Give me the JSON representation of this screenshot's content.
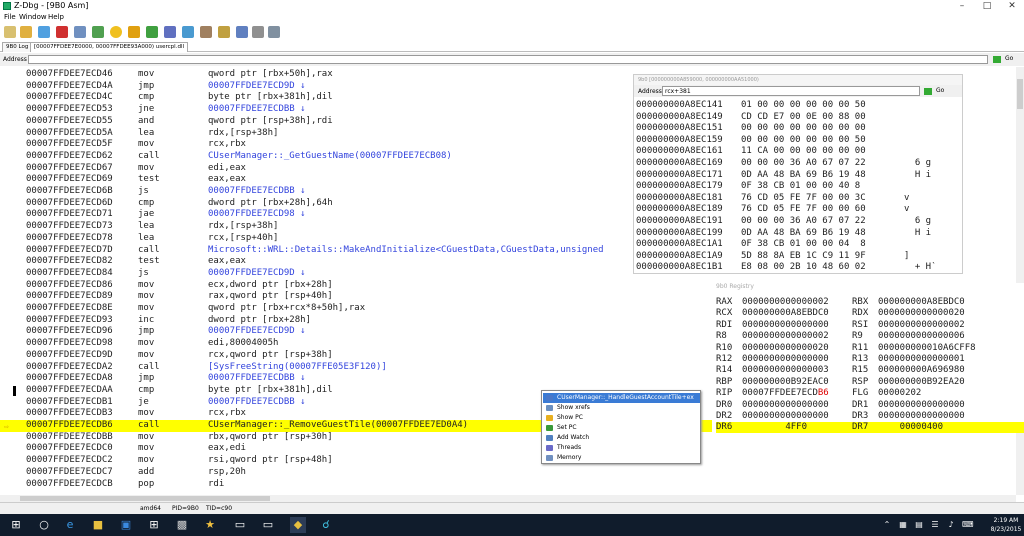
{
  "window": {
    "title": "Z-Dbg - [9B0 Asm]"
  },
  "menu": [
    "File",
    "Window",
    "Help"
  ],
  "tabs": [
    "9B0 Log",
    "[00007FFDEE7E0000, 00007FFDEE93A000) usercpl.dll"
  ],
  "address_bar": {
    "label": "Address",
    "value": "",
    "go": "Go"
  },
  "disasm": [
    {
      "addr": "00007FFDEE7ECD46",
      "mn": "mov",
      "op": "qword ptr [rbx+50h],rax"
    },
    {
      "addr": "00007FFDEE7ECD4A",
      "mn": "jmp",
      "op": "00007FFDEE7ECD9D ↓",
      "link": true
    },
    {
      "addr": "00007FFDEE7ECD4C",
      "mn": "cmp",
      "op": "byte ptr [rbx+381h],dil"
    },
    {
      "addr": "00007FFDEE7ECD53",
      "mn": "jne",
      "op": "00007FFDEE7ECDBB ↓",
      "link": true
    },
    {
      "addr": "00007FFDEE7ECD55",
      "mn": "and",
      "op": "qword ptr [rsp+38h],rdi"
    },
    {
      "addr": "00007FFDEE7ECD5A",
      "mn": "lea",
      "op": "rdx,[rsp+38h]"
    },
    {
      "addr": "00007FFDEE7ECD5F",
      "mn": "mov",
      "op": "rcx,rbx"
    },
    {
      "addr": "00007FFDEE7ECD62",
      "mn": "call",
      "op": "CUserManager::_GetGuestName(00007FFDEE7ECB08)",
      "link": true
    },
    {
      "addr": "00007FFDEE7ECD67",
      "mn": "mov",
      "op": "edi,eax"
    },
    {
      "addr": "00007FFDEE7ECD69",
      "mn": "test",
      "op": "eax,eax"
    },
    {
      "addr": "00007FFDEE7ECD6B",
      "mn": "js",
      "op": "00007FFDEE7ECDBB ↓",
      "link": true
    },
    {
      "addr": "00007FFDEE7ECD6D",
      "mn": "cmp",
      "op": "dword ptr [rbx+28h],64h"
    },
    {
      "addr": "00007FFDEE7ECD71",
      "mn": "jae",
      "op": "00007FFDEE7ECD98 ↓",
      "link": true
    },
    {
      "addr": "00007FFDEE7ECD73",
      "mn": "lea",
      "op": "rdx,[rsp+38h]"
    },
    {
      "addr": "00007FFDEE7ECD78",
      "mn": "lea",
      "op": "rcx,[rsp+40h]"
    },
    {
      "addr": "00007FFDEE7ECD7D",
      "mn": "call",
      "op": "Microsoft::WRL::Details::MakeAndInitialize<CGuestData,CGuestData,unsigned",
      "link": true
    },
    {
      "addr": "00007FFDEE7ECD82",
      "mn": "test",
      "op": "eax,eax"
    },
    {
      "addr": "00007FFDEE7ECD84",
      "mn": "js",
      "op": "00007FFDEE7ECD9D ↓",
      "link": true
    },
    {
      "addr": "00007FFDEE7ECD86",
      "mn": "mov",
      "op": "ecx,dword ptr [rbx+28h]"
    },
    {
      "addr": "00007FFDEE7ECD89",
      "mn": "mov",
      "op": "rax,qword ptr [rsp+40h]"
    },
    {
      "addr": "00007FFDEE7ECD8E",
      "mn": "mov",
      "op": "qword ptr [rbx+rcx*8+50h],rax"
    },
    {
      "addr": "00007FFDEE7ECD93",
      "mn": "inc",
      "op": "dword ptr [rbx+28h]"
    },
    {
      "addr": "00007FFDEE7ECD96",
      "mn": "jmp",
      "op": "00007FFDEE7ECD9D ↓",
      "link": true
    },
    {
      "addr": "00007FFDEE7ECD98",
      "mn": "mov",
      "op": "edi,80004005h"
    },
    {
      "addr": "00007FFDEE7ECD9D",
      "mn": "mov",
      "op": "rcx,qword ptr [rsp+38h]"
    },
    {
      "addr": "00007FFDEE7ECDA2",
      "mn": "call",
      "op": "[SysFreeString(00007FFE05E3F120)]",
      "link": true
    },
    {
      "addr": "00007FFDEE7ECDA8",
      "mn": "jmp",
      "op": "00007FFDEE7ECDBB ↓",
      "link": true
    },
    {
      "addr": "00007FFDEE7ECDAA",
      "mn": "cmp",
      "op": "byte ptr [rbx+381h],dil",
      "bp": true
    },
    {
      "addr": "00007FFDEE7ECDB1",
      "mn": "je",
      "op": "00007FFDEE7ECDBB ↓",
      "link": true
    },
    {
      "addr": "00007FFDEE7ECDB3",
      "mn": "mov",
      "op": "rcx,rbx"
    },
    {
      "addr": "00007FFDEE7ECDB6",
      "mn": "call",
      "op": "CUserManager::_RemoveGuestTile(00007FFDEE7ED0A4)",
      "current": true
    },
    {
      "addr": "00007FFDEE7ECDBB",
      "mn": "mov",
      "op": "rbx,qword ptr [rsp+30h]"
    },
    {
      "addr": "00007FFDEE7ECDC0",
      "mn": "mov",
      "op": "eax,edi"
    },
    {
      "addr": "00007FFDEE7ECDC2",
      "mn": "mov",
      "op": "rsi,qword ptr [rsp+48h]"
    },
    {
      "addr": "00007FFDEE7ECDC7",
      "mn": "add",
      "op": "rsp,20h"
    },
    {
      "addr": "00007FFDEE7ECDCB",
      "mn": "pop",
      "op": "rdi"
    }
  ],
  "memory": {
    "title": "9b0 [000000000A859000, 000000000AA51000)",
    "address_label": "Address",
    "address_value": "rcx+381",
    "go": "Go",
    "rows": [
      {
        "addr": "000000000A8EC141",
        "hex": "01 00 00 00 00 00 00 50",
        "ascii": ""
      },
      {
        "addr": "000000000A8EC149",
        "hex": "CD CD E7 00 0E 00 88 00",
        "ascii": ""
      },
      {
        "addr": "000000000A8EC151",
        "hex": "00 00 00 00 00 00 00 00",
        "ascii": ""
      },
      {
        "addr": "000000000A8EC159",
        "hex": "00 00 00 00 00 00 00 50",
        "ascii": ""
      },
      {
        "addr": "000000000A8EC161",
        "hex": "11 CA 00 00 00 00 00 00",
        "ascii": ""
      },
      {
        "addr": "000000000A8EC169",
        "hex": "00 00 00 36 A0 67 07 22",
        "ascii": "  6 g"
      },
      {
        "addr": "000000000A8EC171",
        "hex": "0D AA 48 BA 69 B6 19 48",
        "ascii": "  H i"
      },
      {
        "addr": "000000000A8EC179",
        "hex": "0F 38 CB 01 00 00 40 8",
        "ascii": ""
      },
      {
        "addr": "000000000A8EC181",
        "hex": "76 CD 05 FE 7F 00 00 3C",
        "ascii": "v"
      },
      {
        "addr": "000000000A8EC189",
        "hex": "76 CD 05 FE 7F 00 00 60",
        "ascii": "v"
      },
      {
        "addr": "000000000A8EC191",
        "hex": "00 00 00 36 A0 67 07 22",
        "ascii": "  6 g"
      },
      {
        "addr": "000000000A8EC199",
        "hex": "0D AA 48 BA 69 B6 19 48",
        "ascii": "  H i"
      },
      {
        "addr": "000000000A8EC1A1",
        "hex": "0F 38 CB 01 00 00 04  8",
        "ascii": ""
      },
      {
        "addr": "000000000A8EC1A9",
        "hex": "5D 88 8A EB 1C C9 11 9F",
        "ascii": "]"
      },
      {
        "addr": "000000000A8EC1B1",
        "hex": "E8 08 00 2B 10 48 60 02",
        "ascii": "  + H`"
      }
    ]
  },
  "registers": {
    "title": "9b0 Registry",
    "rows": [
      {
        "n1": "RAX",
        "v1": "0000000000000002",
        "n2": "RBX",
        "v2": "000000000A8EBDC0"
      },
      {
        "n1": "RCX",
        "v1": "000000000A8EBDC0",
        "n2": "RDX",
        "v2": "0000000000000020"
      },
      {
        "n1": "RDI",
        "v1": "0000000000000000",
        "n2": "RSI",
        "v2": "0000000000000002"
      },
      {
        "n1": "R8",
        "v1": "0000000000000002",
        "n2": "R9",
        "v2": "0000000000000006"
      },
      {
        "n1": "R10",
        "v1": "0000000000000020",
        "n2": "R11",
        "v2": "000000000010A6CFF8"
      },
      {
        "n1": "R12",
        "v1": "0000000000000000",
        "n2": "R13",
        "v2": "0000000000000001"
      },
      {
        "n1": "R14",
        "v1": "0000000000000003",
        "n2": "R15",
        "v2": "000000000A696980"
      },
      {
        "n1": "RBP",
        "v1": "000000000B92EAC0",
        "n2": "RSP",
        "v2": "000000000B92EA20"
      },
      {
        "n1": "RIP",
        "v1": "00007FFDEE7ECD",
        "v1red": "B6",
        "n2": "FLG",
        "v2": "00000202"
      },
      {
        "n1": "DR0",
        "v1": "0000000000000000",
        "n2": "DR1",
        "v2": "0000000000000000"
      },
      {
        "n1": "DR2",
        "v1": "0000000000000000",
        "n2": "DR3",
        "v2": "0000000000000000"
      },
      {
        "n1": "DR6",
        "v1": "        4FF0",
        "n2": "DR7",
        "v2": "    00000400",
        "hl": true
      }
    ]
  },
  "context_menu": [
    {
      "label": "CUserManager::_HandleGuestAccountTile+ex",
      "icon": "function-icon",
      "color": "#4a78c8",
      "selected": true
    },
    {
      "label": "Show xrefs",
      "icon": "xrefs-icon",
      "color": "#6a8fc0"
    },
    {
      "label": "Show PC",
      "icon": "arrow-icon",
      "color": "#e8b020"
    },
    {
      "label": "Set PC",
      "icon": "pc-icon",
      "color": "#3a9a3a"
    },
    {
      "label": "Add Watch",
      "icon": "watch-icon",
      "color": "#5080c0"
    },
    {
      "label": "Threads",
      "icon": "threads-icon",
      "color": "#6a6ac8"
    },
    {
      "label": "Memory",
      "icon": "memory-icon",
      "color": "#7090c0"
    }
  ],
  "status": {
    "arch": "amd64",
    "pid": "PID=9B0",
    "tid": "TID=c90"
  },
  "taskbar": {
    "time": "2:19 AM",
    "date": "8/23/2015"
  }
}
